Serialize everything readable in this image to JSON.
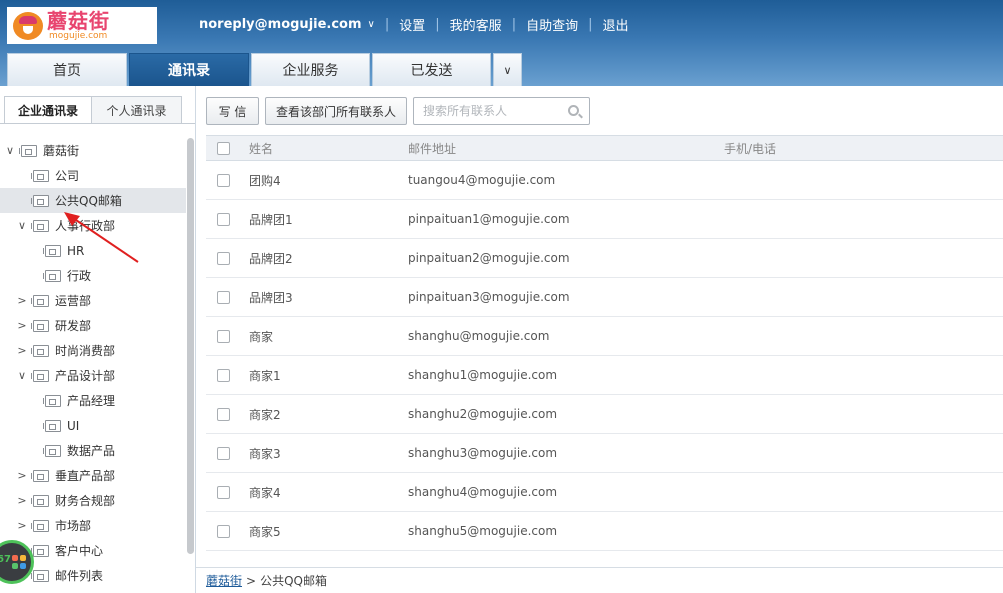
{
  "logo": {
    "name_cn": "蘑菇街",
    "name_en": "mogujie.com"
  },
  "topbar": {
    "email": "noreply@mogujie.com",
    "links": [
      "设置",
      "我的客服",
      "自助查询",
      "退出"
    ]
  },
  "main_tabs": [
    {
      "label": "首页"
    },
    {
      "label": "通讯录"
    },
    {
      "label": "企业服务"
    },
    {
      "label": "已发送"
    }
  ],
  "left": {
    "subtabs": [
      {
        "label": "企业通讯录"
      },
      {
        "label": "个人通讯录"
      }
    ],
    "tree": [
      {
        "label": "蘑菇街",
        "level": 0,
        "toggle": "∨"
      },
      {
        "label": "公司",
        "level": 1,
        "toggle": ""
      },
      {
        "label": "公共QQ邮箱",
        "level": 1,
        "toggle": "",
        "selected": true
      },
      {
        "label": "人事行政部",
        "level": 1,
        "toggle": "∨"
      },
      {
        "label": "HR",
        "level": 2,
        "toggle": ""
      },
      {
        "label": "行政",
        "level": 2,
        "toggle": ""
      },
      {
        "label": "运营部",
        "level": 1,
        "toggle": ">"
      },
      {
        "label": "研发部",
        "level": 1,
        "toggle": ">"
      },
      {
        "label": "时尚消费部",
        "level": 1,
        "toggle": ">"
      },
      {
        "label": "产品设计部",
        "level": 1,
        "toggle": "∨"
      },
      {
        "label": "产品经理",
        "level": 2,
        "toggle": ""
      },
      {
        "label": "UI",
        "level": 2,
        "toggle": ""
      },
      {
        "label": "数据产品",
        "level": 2,
        "toggle": ""
      },
      {
        "label": "垂直产品部",
        "level": 1,
        "toggle": ">"
      },
      {
        "label": "财务合规部",
        "level": 1,
        "toggle": ">"
      },
      {
        "label": "市场部",
        "level": 1,
        "toggle": ">"
      },
      {
        "label": "客户中心",
        "level": 1,
        "toggle": ""
      },
      {
        "label": "邮件列表",
        "level": 1,
        "toggle": ""
      }
    ],
    "badge_number": "67"
  },
  "toolbar": {
    "write_label": "写 信",
    "view_all_label": "查看该部门所有联系人",
    "search_placeholder": "搜索所有联系人"
  },
  "table": {
    "headers": {
      "name": "姓名",
      "email": "邮件地址",
      "phone": "手机/电话"
    },
    "rows": [
      {
        "name": "团购4",
        "email": "tuangou4@mogujie.com"
      },
      {
        "name": "品牌团1",
        "email": "pinpaituan1@mogujie.com"
      },
      {
        "name": "品牌团2",
        "email": "pinpaituan2@mogujie.com"
      },
      {
        "name": "品牌团3",
        "email": "pinpaituan3@mogujie.com"
      },
      {
        "name": "商家",
        "email": "shanghu@mogujie.com"
      },
      {
        "name": "商家1",
        "email": "shanghu1@mogujie.com"
      },
      {
        "name": "商家2",
        "email": "shanghu2@mogujie.com"
      },
      {
        "name": "商家3",
        "email": "shanghu3@mogujie.com"
      },
      {
        "name": "商家4",
        "email": "shanghu4@mogujie.com"
      },
      {
        "name": "商家5",
        "email": "shanghu5@mogujie.com"
      }
    ]
  },
  "breadcrumb": {
    "root": "蘑菇街",
    "separator": ">",
    "current": "公共QQ邮箱"
  },
  "colors": {
    "header": "#2d6ba6",
    "active_tab": "#1f5e98",
    "link": "#1c5a99",
    "annotation_arrow": "#e02020"
  }
}
